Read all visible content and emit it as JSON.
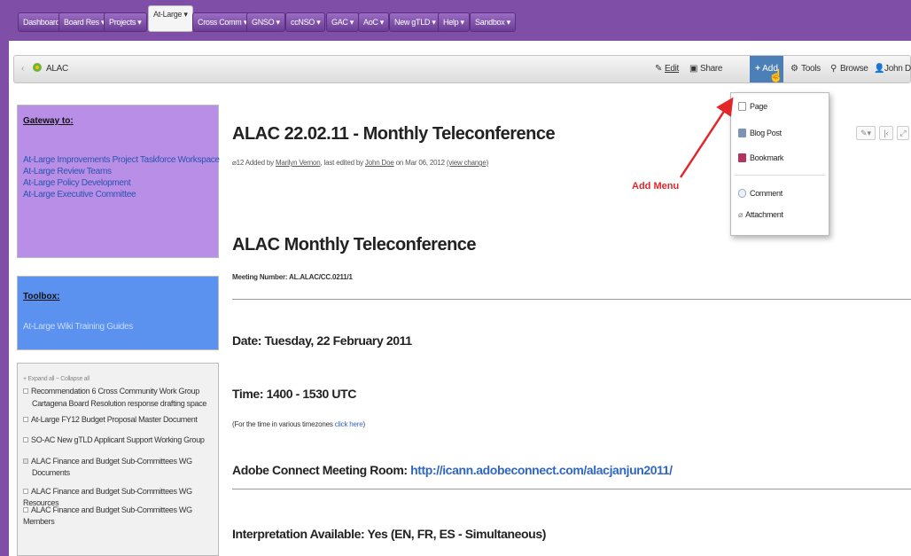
{
  "nav": {
    "items": [
      {
        "label": "Dashboard"
      },
      {
        "label": "Board Res ▾"
      },
      {
        "label": "Projects ▾"
      },
      {
        "label": "At-Large ▾"
      },
      {
        "label": "Cross Comm ▾"
      },
      {
        "label": "GNSO ▾"
      },
      {
        "label": "ccNSO ▾"
      },
      {
        "label": "GAC ▾"
      },
      {
        "label": "AoC ▾"
      },
      {
        "label": "New gTLD ▾"
      },
      {
        "label": "Help ▾"
      },
      {
        "label": "Sandbox ▾"
      }
    ]
  },
  "breadcrumb": {
    "space": "ALAC"
  },
  "toolbar": {
    "edit": "Edit",
    "share": "Share",
    "add": "Add",
    "tools": "Tools",
    "browse": "Browse",
    "user": "John Doe"
  },
  "add_menu": {
    "items": [
      "Page",
      "Blog Post",
      "Bookmark"
    ],
    "items2": [
      "Comment",
      "Attachment"
    ],
    "annotation": "Add Menu"
  },
  "sidebar": {
    "gateway": {
      "title": "Gateway to:",
      "links": [
        "At-Large Improvements Project Taskforce Workspace",
        "At-Large Review Teams",
        "At-Large Policy Development",
        "At-Large Executive Committee"
      ]
    },
    "toolbox": {
      "title": "Toolbox:",
      "links": [
        "At-Large Wiki Training Guides"
      ]
    },
    "tree": {
      "controls": "+ Expand all   − Collapse all",
      "items": [
        "Recommendation 6 Cross Community Work Group",
        "Cartagena Board Resolution response drafting space",
        "At-Large FY12 Budget Proposal Master Document",
        "SO-AC New gTLD Applicant Support Working Group",
        "ALAC Finance and Budget Sub-Committees WG",
        "Documents",
        "ALAC Finance and Budget Sub-Committees WG Resources",
        "ALAC Finance and Budget Sub-Committees WG Members"
      ]
    }
  },
  "page": {
    "title": "ALAC 22.02.11 - Monthly Teleconference",
    "meta_prefix": "12  Added by ",
    "meta_author": "Marilyn Vernon",
    "meta_mid": ", last edited by ",
    "meta_editor": "John Doe",
    "meta_date": " on Mar 06, 2012  ",
    "meta_view": "(view change)",
    "heading": "ALAC Monthly Teleconference",
    "meeting_number": "Meeting Number: AL.ALAC/CC.0211/1",
    "date": "Date: Tuesday, 22 February 2011",
    "time": "Time: 1400 - 1530 UTC",
    "tz_note": "(For the time in various timezones ",
    "tz_link": "click here",
    "tz_close": ")",
    "adobe_label": "Adobe Connect Meeting Room: ",
    "adobe_url": "http://icann.adobeconnect.com/alacjanjun2011/",
    "interpretation": "Interpretation Available: Yes (EN, FR, ES - Simultaneous)"
  }
}
